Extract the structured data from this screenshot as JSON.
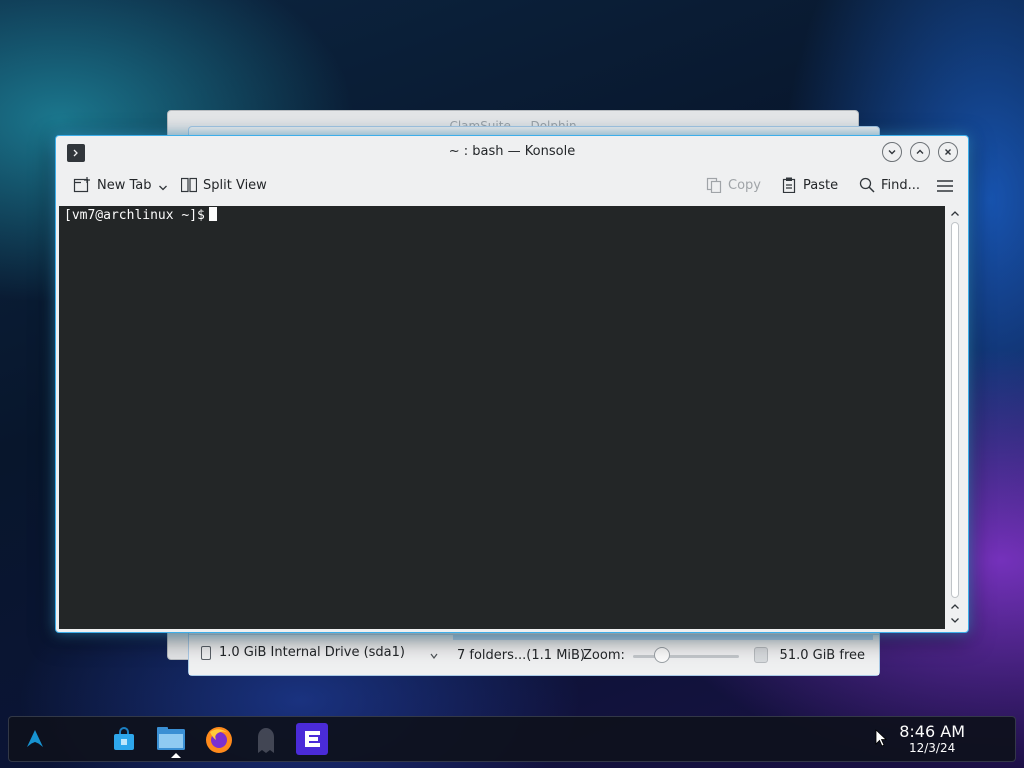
{
  "background_windows": {
    "dolphin_title": "ClamSuite — Dolphin",
    "places_item": "1.0 GiB Internal Drive (sda1)",
    "folders_info": "7 folders...(1.1 MiB)",
    "zoom_label": "Zoom:",
    "free_space": "51.0 GiB free"
  },
  "konsole": {
    "title": "~ : bash — Konsole",
    "toolbar": {
      "new_tab_label": "New Tab",
      "split_view_label": "Split View",
      "copy_label": "Copy",
      "paste_label": "Paste",
      "find_label": "Find..."
    },
    "terminal": {
      "prompt": "[vm7@archlinux ~]$"
    }
  },
  "taskbar": {
    "apps": [
      "app-launcher",
      "discover",
      "dolphin",
      "firefox",
      "ghost-app",
      "app-e"
    ],
    "clock_time": "8:46 AM",
    "clock_date": "12/3/24"
  },
  "colors": {
    "accent": "#3daee9",
    "terminal_bg": "#232627",
    "window_bg": "#eff0f1"
  }
}
